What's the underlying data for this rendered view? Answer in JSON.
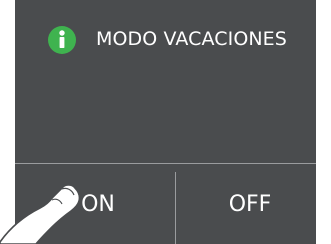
{
  "dialog": {
    "title": "MODO VACACIONES",
    "icon": "info-icon",
    "accent_color": "#3fb34f",
    "background_color": "#4a4c4e"
  },
  "buttons": {
    "on_label": "ON",
    "off_label": "OFF"
  },
  "overlay": {
    "icon": "pointing-hand-icon"
  }
}
